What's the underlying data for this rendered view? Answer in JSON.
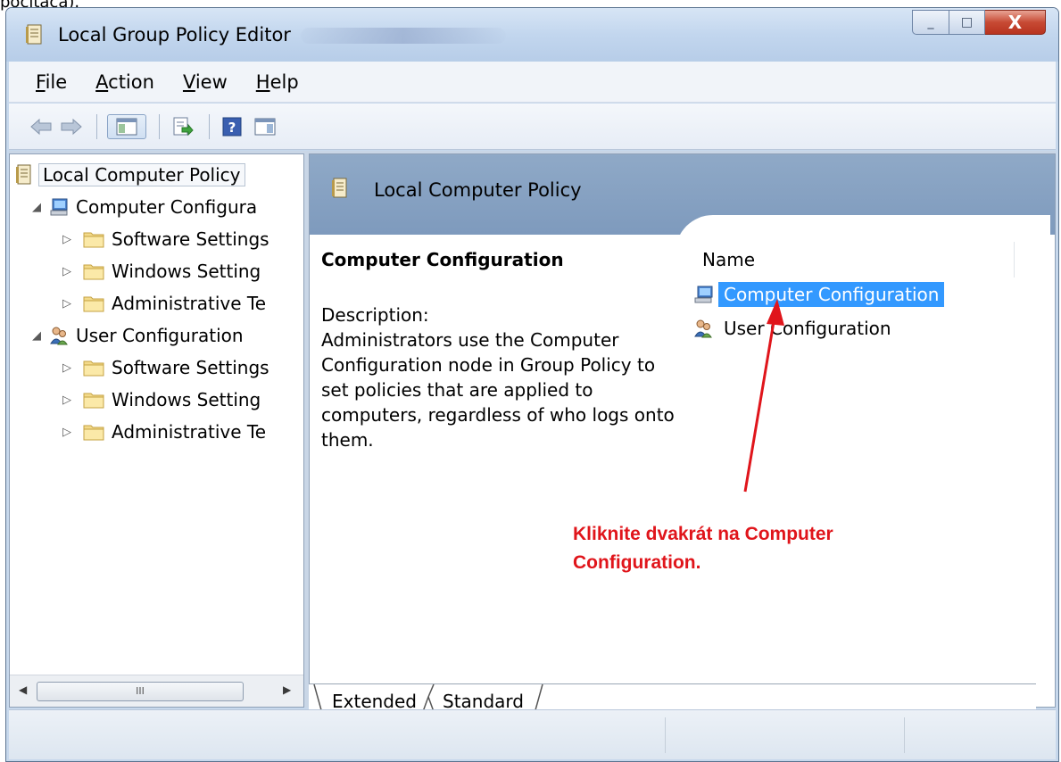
{
  "top_text": "počítača).",
  "window": {
    "title": "Local Group Policy Editor"
  },
  "title_buttons": {
    "minimize": "_",
    "maximize": "□",
    "close": "X"
  },
  "menu": [
    {
      "label": "File",
      "key": "F",
      "rest": "ile"
    },
    {
      "label": "Action",
      "key": "A",
      "rest": "ction"
    },
    {
      "label": "View",
      "key": "V",
      "rest": "iew"
    },
    {
      "label": "Help",
      "key": "H",
      "rest": "elp"
    }
  ],
  "tree": {
    "root": "Local Computer Policy",
    "computer": "Computer Configura",
    "computer_children": [
      "Software Settings",
      "Windows Setting",
      "Administrative Te"
    ],
    "user": "User Configuration",
    "user_children": [
      "Software Settings",
      "Windows Setting",
      "Administrative Te"
    ]
  },
  "scroll": {
    "thumb_label": "III"
  },
  "right": {
    "header_title": "Local Computer Policy",
    "desc_title": "Computer Configuration",
    "desc_label": "Description:",
    "desc_text": "Administrators use the Computer Configuration node in Group Policy to set policies that are applied to computers, regardless of who logs onto them.",
    "column_name": "Name",
    "items": [
      "Computer Configuration",
      "User Configuration"
    ]
  },
  "annotation": {
    "line1": "Kliknite dvakrát na Computer",
    "line2": "Configuration.",
    "color": "#e0151b"
  },
  "tabs": [
    "Extended",
    "Standard"
  ],
  "colors": {
    "selection": "#3399ff",
    "header": "#7e9abd"
  }
}
